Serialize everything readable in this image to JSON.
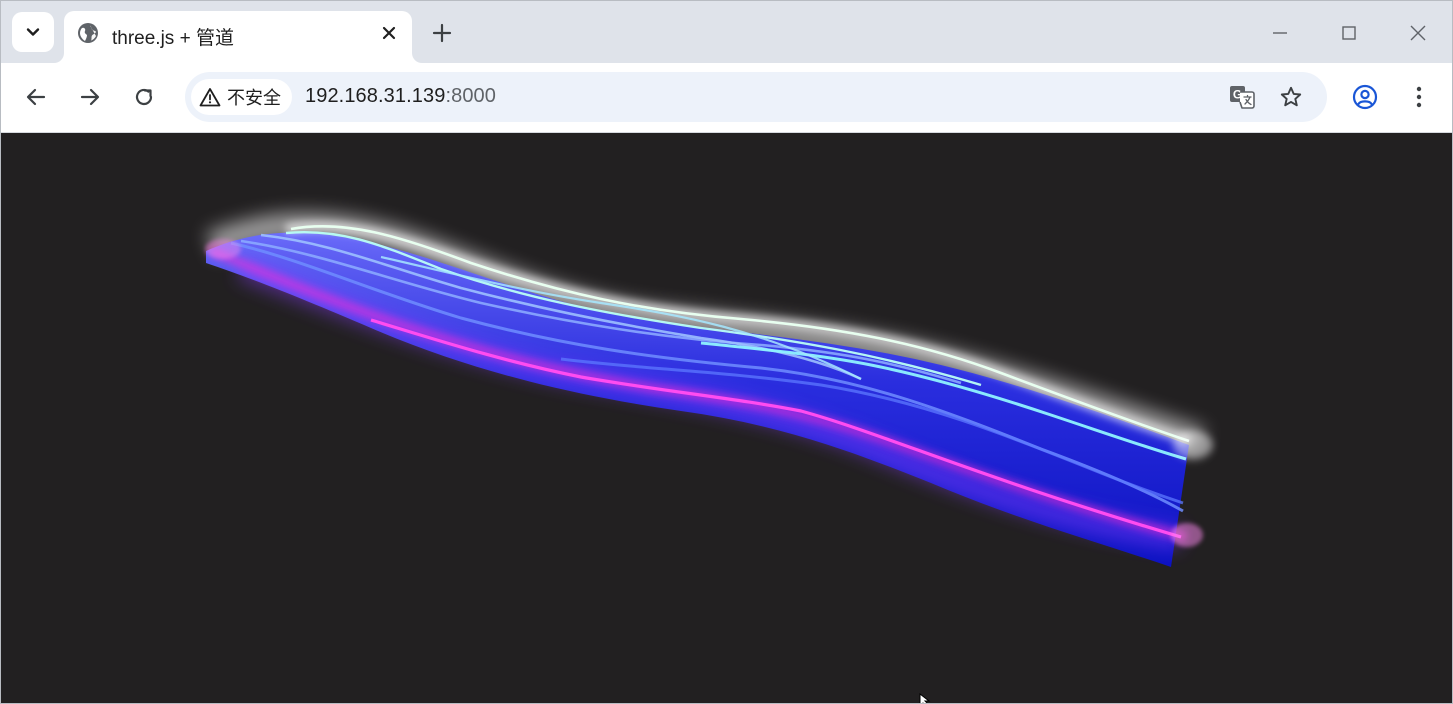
{
  "tab": {
    "title": "three.js + 管道",
    "favicon_icon": "globe-icon",
    "close_icon": "close-icon"
  },
  "tabstrip": {
    "search_icon": "chevron-down-icon",
    "new_tab_icon": "plus-icon"
  },
  "window_controls": {
    "minimize_icon": "minimize-icon",
    "maximize_icon": "maximize-icon",
    "close_icon": "close-icon"
  },
  "toolbar": {
    "back_icon": "arrow-left-icon",
    "forward_icon": "arrow-right-icon",
    "reload_icon": "reload-icon",
    "security_icon": "warning-triangle-icon",
    "security_text": "不安全",
    "url_host": "192.168.31.139",
    "url_port": ":8000",
    "translate_icon": "translate-icon",
    "bookmark_icon": "star-icon",
    "profile_icon": "account-circle-icon",
    "menu_icon": "more-vertical-icon"
  },
  "scene": {
    "description_colors": {
      "background": "#222021",
      "ribbon_dark": "#0b12c8",
      "ribbon_mid": "#3a3df0",
      "magenta_line": "#ff2bd6",
      "cyan_line": "#8ff3ff",
      "light_blue_line": "#7aa6ff",
      "glow": "#ffffff"
    }
  }
}
